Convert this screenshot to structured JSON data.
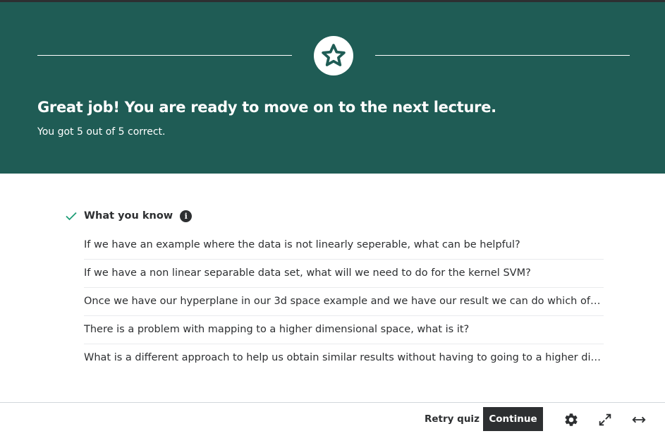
{
  "hero": {
    "icon": "star-icon",
    "title": "Great job! You are ready to move on to the next lecture.",
    "subtitle": "You got 5 out of 5 correct.",
    "background_color": "#1f5c55"
  },
  "section": {
    "icon": "check-icon",
    "title": "What you know",
    "info_icon": "info-icon",
    "check_color": "#1e9d77",
    "questions": [
      "If we have an example where the data is not linearly seperable, what can be helpful?",
      "If we have a non linear separable data set, what will we need to do for the kernel SVM?",
      "Once we have our hyperplane in our 3d space example and we have our result we can do which of the following?",
      "There is a problem with mapping to a higher dimensional space, what is it?",
      "What is a different approach to help us obtain similar results without having to going to a higher dimensional space?"
    ]
  },
  "footer": {
    "retry_label": "Retry quiz",
    "continue_label": "Continue",
    "icons": [
      "gear-icon",
      "expand-icon",
      "resize-horizontal-icon"
    ]
  }
}
